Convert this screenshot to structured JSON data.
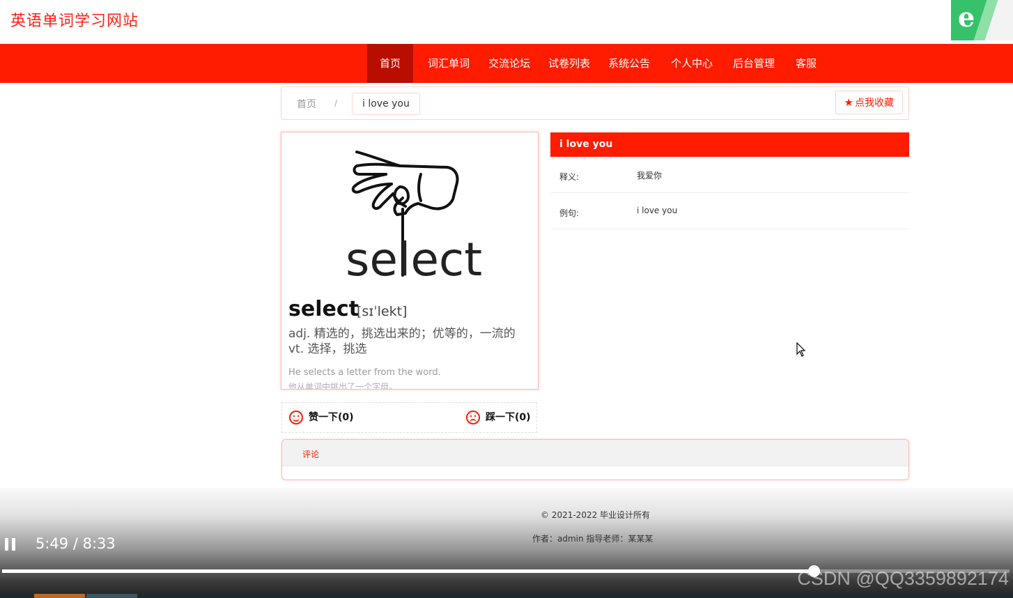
{
  "header": {
    "site_title": "英语单词学习网站",
    "browser_badge_char": "e"
  },
  "nav": {
    "items": [
      {
        "label": "首页",
        "active": true
      },
      {
        "label": "词汇单词",
        "active": false
      },
      {
        "label": "交流论坛",
        "active": false
      },
      {
        "label": "试卷列表",
        "active": false
      },
      {
        "label": "系统公告",
        "active": false
      },
      {
        "label": "个人中心",
        "active": false
      },
      {
        "label": "后台管理",
        "active": false
      },
      {
        "label": "客服",
        "active": false
      }
    ]
  },
  "breadcrumb": {
    "home": "首页",
    "separator": "/",
    "current": "i love you"
  },
  "favorite_button": "点我收藏",
  "image_card": {
    "illustration_word": "select",
    "word": "select",
    "phonetic": "[sɪˈlekt]",
    "def_adj": "adj. 精选的，挑选出来的；优等的，一流的",
    "def_vt": "vt. 选择，挑选",
    "example_en": "He selects a letter from the word.",
    "example_zh": "他从单词中挑出了一个字母。"
  },
  "votes": {
    "like_label": "赞一下(0)",
    "dislike_label": "踩一下(0)"
  },
  "detail": {
    "title": "i love you",
    "rows": [
      {
        "label": "释义:",
        "value": "我爱你"
      },
      {
        "label": "例句:",
        "value": "i love you"
      }
    ]
  },
  "comments": {
    "tab_label": "评论"
  },
  "footer": {
    "copyright": "© 2021-2022 毕业设计所有",
    "author": "作者：admin 指导老师：某某某"
  },
  "video": {
    "time": "5:49 / 8:33",
    "progress_fraction": 0.806
  },
  "watermark": "CSDN @QQ3359892174",
  "colors": {
    "brand_red": "#ff1c00",
    "nav_active": "#b80e00"
  }
}
